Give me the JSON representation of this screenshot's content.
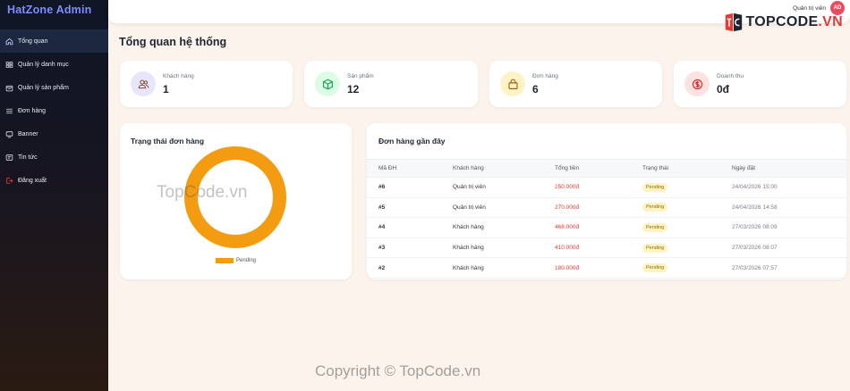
{
  "sidebar": {
    "brand": "HatZone Admin",
    "items": [
      {
        "label": "Tổng quan",
        "icon": "home-icon",
        "active": true
      },
      {
        "label": "Quản lý danh mục",
        "icon": "grid-icon"
      },
      {
        "label": "Quản lý sản phẩm",
        "icon": "box-icon"
      },
      {
        "label": "Đơn hàng",
        "icon": "list-icon"
      },
      {
        "label": "Banner",
        "icon": "monitor-icon"
      },
      {
        "label": "Tin tức",
        "icon": "news-icon"
      },
      {
        "label": "Đăng xuất",
        "icon": "logout-icon",
        "color": "#e53935"
      }
    ]
  },
  "header": {
    "user_name": "Quản trị viên",
    "avatar_initials": "AD",
    "logo_text": "TOPCODE",
    "logo_suffix": ".VN"
  },
  "page_title": "Tổng quan hệ thống",
  "stats": [
    {
      "label": "Khách hàng",
      "value": "1",
      "icon": "users-icon",
      "color": "#6c63ff"
    },
    {
      "label": "Sản phẩm",
      "value": "12",
      "icon": "cube-icon",
      "color": "#22c55e"
    },
    {
      "label": "Đơn hàng",
      "value": "6",
      "icon": "bag-icon",
      "color": "#eab308"
    },
    {
      "label": "Doanh thu",
      "value": "0đ",
      "icon": "dollar-icon",
      "color": "#e53935"
    }
  ],
  "status_panel": {
    "title": "Trạng thái đơn hàng",
    "legend": "Pending"
  },
  "chart_data": {
    "type": "pie",
    "categories": [
      "Pending"
    ],
    "values": [
      6
    ],
    "colors": [
      "#f39c12"
    ],
    "title": "Trạng thái đơn hàng",
    "legend_position": "bottom"
  },
  "orders_panel": {
    "title": "Đơn hàng gần đây",
    "columns": [
      "Mã ĐH",
      "Khách hàng",
      "Tổng tiền",
      "Trạng thái",
      "Ngày đặt"
    ],
    "rows": [
      {
        "id": "#6",
        "customer": "Quản trị viên",
        "total": "250.000đ",
        "status": "Pending",
        "date": "24/04/2026 15:00"
      },
      {
        "id": "#5",
        "customer": "Quản trị viên",
        "total": "270.000đ",
        "status": "Pending",
        "date": "24/04/2026 14:58"
      },
      {
        "id": "#4",
        "customer": "Khách hàng",
        "total": "468.000đ",
        "status": "Pending",
        "date": "27/03/2026 08:09"
      },
      {
        "id": "#3",
        "customer": "Khách hàng",
        "total": "410.000đ",
        "status": "Pending",
        "date": "27/03/2026 08:07"
      },
      {
        "id": "#2",
        "customer": "Khách hàng",
        "total": "180.000đ",
        "status": "Pending",
        "date": "27/03/2026 07:57"
      }
    ]
  },
  "watermark": "TopCode.vn",
  "footer": "Copyright © TopCode.vn"
}
